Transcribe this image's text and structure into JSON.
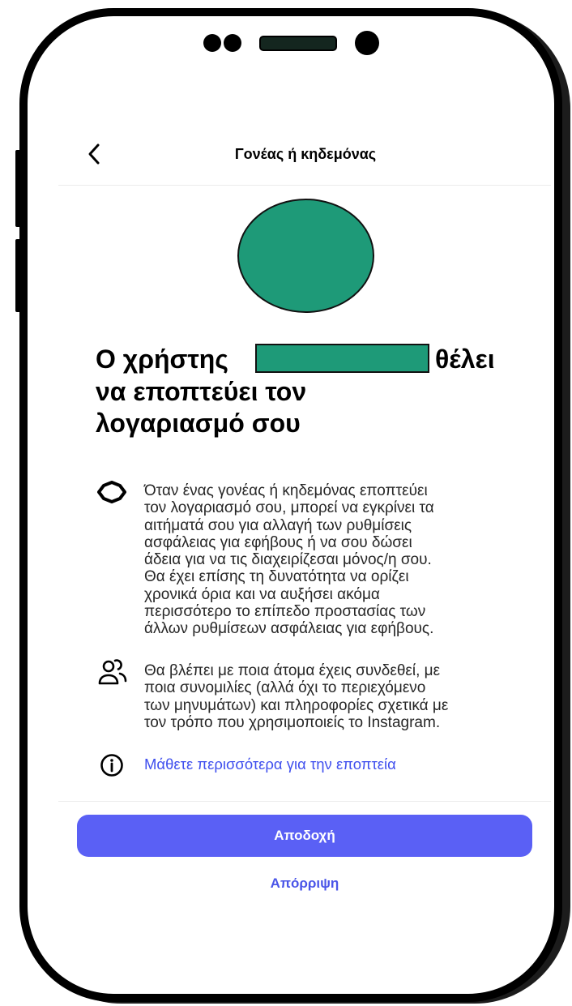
{
  "header": {
    "back_icon": "chevron-left-icon",
    "title": "Γονέας ή κηδεμόνας"
  },
  "avatar": {
    "color": "#1e9a78"
  },
  "heading": {
    "part1": "Ο χρήστης",
    "part2": "θέλει",
    "line2": "να εποπτεύει τον",
    "line3": "λογαριασμό σου",
    "redaction_color": "#1e9a78"
  },
  "items": [
    {
      "icon": "supervision-badge-icon",
      "lines": [
        "Όταν ένας γονέας ή κηδεμόνας εποπτεύει",
        "τον λογαριασμό σου, μπορεί να εγκρίνει τα",
        "αιτήματά σου για αλλαγή των ρυθμίσεις",
        "ασφάλειας για εφήβους ή να σου δώσει",
        "άδεια για να τις διαχειρίζεσαι μόνος/η σου.",
        "Θα έχει επίσης τη δυνατότητα να ορίζει",
        "χρονικά όρια και να αυξήσει ακόμα",
        "περισσότερο το επίπεδο προστασίας των",
        "άλλων ρυθμίσεων ασφάλειας για εφήβους."
      ]
    },
    {
      "icon": "people-icon",
      "lines": [
        "Θα βλέπει με ποια άτομα έχεις συνδεθεί, με",
        "ποια συνομιλίες (αλλά όχι το περιεχόμενο",
        "των μηνυμάτων) και πληροφορίες σχετικά με",
        "τον τρόπο που χρησιμοποιείς το Instagram."
      ]
    }
  ],
  "learn_more": {
    "icon": "info-icon",
    "label": "Μάθετε περισσότερα για την εποπτεία"
  },
  "accept_button": {
    "label": "Αποδοχή",
    "color": "#5a60f5"
  },
  "decline_link": {
    "label": "Απόρριψη",
    "color": "#4a55e8"
  }
}
